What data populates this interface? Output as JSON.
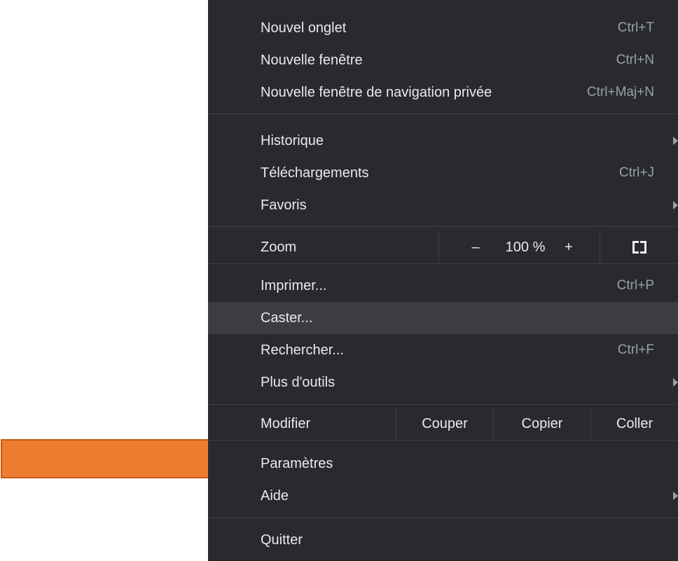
{
  "menu": {
    "new_tab": {
      "label": "Nouvel onglet",
      "shortcut": "Ctrl+T"
    },
    "new_window": {
      "label": "Nouvelle fenêtre",
      "shortcut": "Ctrl+N"
    },
    "new_private_window": {
      "label": "Nouvelle fenêtre de navigation privée",
      "shortcut": "Ctrl+Maj+N"
    },
    "history": {
      "label": "Historique"
    },
    "downloads": {
      "label": "Téléchargements",
      "shortcut": "Ctrl+J"
    },
    "bookmarks": {
      "label": "Favoris"
    },
    "zoom": {
      "label": "Zoom",
      "minus": "–",
      "value": "100 %",
      "plus": "+"
    },
    "print": {
      "label": "Imprimer...",
      "shortcut": "Ctrl+P"
    },
    "cast": {
      "label": "Caster..."
    },
    "find": {
      "label": "Rechercher...",
      "shortcut": "Ctrl+F"
    },
    "more_tools": {
      "label": "Plus d'outils"
    },
    "edit": {
      "label": "Modifier",
      "cut": "Couper",
      "copy": "Copier",
      "paste": "Coller"
    },
    "settings": {
      "label": "Paramètres"
    },
    "help": {
      "label": "Aide"
    },
    "quit": {
      "label": "Quitter"
    }
  },
  "colors": {
    "menu_bg": "#292a2d",
    "highlight_bg": "#3c3d40",
    "text": "#e8eaed",
    "shortcut_text": "#9aa0a6",
    "separator": "#3c4043",
    "annotation_arrow": "#ed7d31"
  },
  "icons": {
    "fullscreen": "fullscreen-icon",
    "submenu": "chevron-right-icon",
    "annotation": "arrow-right-icon"
  }
}
